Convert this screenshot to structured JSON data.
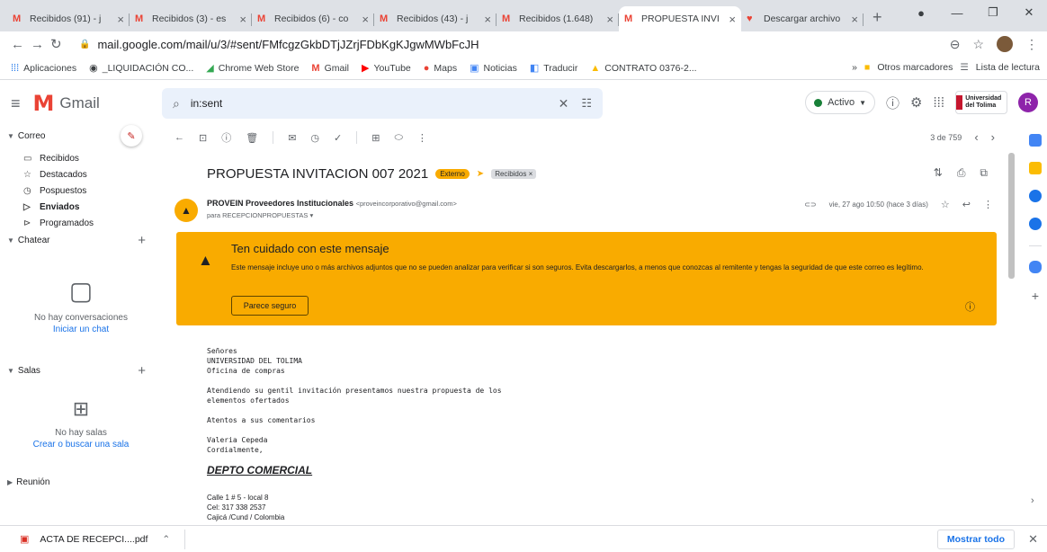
{
  "browser": {
    "tabs": [
      {
        "title": "Recibidos (91) - j",
        "icon": "gmail-icon"
      },
      {
        "title": "Recibidos (3) - es",
        "icon": "gmail-icon"
      },
      {
        "title": "Recibidos (6) - co",
        "icon": "gmail-icon"
      },
      {
        "title": "Recibidos (43) - j",
        "icon": "gmail-icon"
      },
      {
        "title": "Recibidos (1.648)",
        "icon": "gmail-icon"
      },
      {
        "title": "PROPUESTA INVI",
        "icon": "gmail-icon",
        "active": true
      },
      {
        "title": "Descargar archivo",
        "icon": "heart-icon"
      }
    ],
    "url": "mail.google.com/mail/u/3/#sent/FMfcgzGkbDTjJZrjFDbKgKJgwMWbFcJH",
    "bookmarks": [
      {
        "label": "Aplicaciones",
        "icon": "apps-icon"
      },
      {
        "label": "_LIQUIDACIÓN CO...",
        "icon": "globe-icon"
      },
      {
        "label": "Chrome Web Store",
        "icon": "chrome-store-icon"
      },
      {
        "label": "Gmail",
        "icon": "gmail-icon"
      },
      {
        "label": "YouTube",
        "icon": "youtube-icon"
      },
      {
        "label": "Maps",
        "icon": "maps-icon"
      },
      {
        "label": "Noticias",
        "icon": "news-icon"
      },
      {
        "label": "Traducir",
        "icon": "translate-icon"
      },
      {
        "label": "CONTRATO 0376-2...",
        "icon": "drive-icon"
      }
    ],
    "other_bookmarks": "Otros marcadores",
    "reading_list": "Lista de lectura"
  },
  "gmail": {
    "logo_text": "Gmail",
    "search_value": "in:sent",
    "status": "Activo",
    "avatar_letter": "R",
    "org_logo_text": "Universidad del Tolima"
  },
  "sidebar": {
    "mail_section": "Correo",
    "items": [
      {
        "label": "Recibidos",
        "icon": "inbox-icon"
      },
      {
        "label": "Destacados",
        "icon": "star-icon"
      },
      {
        "label": "Pospuestos",
        "icon": "clock-icon"
      },
      {
        "label": "Enviados",
        "icon": "send-icon",
        "selected": true
      },
      {
        "label": "Programados",
        "icon": "scheduled-icon"
      }
    ],
    "chat_section": "Chatear",
    "chat_empty": "No hay conversaciones",
    "chat_link": "Iniciar un chat",
    "rooms_section": "Salas",
    "rooms_empty": "No hay salas",
    "rooms_link": "Crear o buscar una sala",
    "meet_section": "Reunión"
  },
  "message": {
    "pager": "3 de 759",
    "subject": "PROPUESTA INVITACION 007 2021",
    "external_badge": "Externo",
    "label": "Recibidos",
    "sender_name": "PROVEIN Proveedores Institucionales",
    "sender_email": "<proveincorporativo@gmail.com>",
    "to": "para RECEPCIONPROPUESTAS",
    "date": "vie, 27 ago 10:50 (hace 3 días)",
    "warning_title": "Ten cuidado con este mensaje",
    "warning_text": "Este mensaje incluye uno o más archivos adjuntos que no se pueden analizar para verificar si son seguros. Evita descargarlos, a menos que conozcas al remitente y tengas la seguridad de que este correo es legítimo.",
    "safe_button": "Parece seguro",
    "body": "Señores\nUNIVERSIDAD DEL TOLIMA\nOficina de compras\n\nAtendiendo su gentil invitación presentamos nuestra propuesta de los\nelementos ofertados\n\nAtentos a sus comentarios\n\nValeria Cepeda\nCordialmente,",
    "signature_company": "DEPTO COMERCIAL",
    "signature_contact": "Calle 1 # 5 - local  8\nCel: 317 338 2537\nCajicá /Cund / Colombia"
  },
  "downloads": {
    "file": "ACTA DE RECEPCI....pdf",
    "show_all": "Mostrar todo"
  },
  "colors": {
    "warning": "#f9ab00",
    "accent": "#1a73e8",
    "gmail_red": "#ea4335"
  }
}
